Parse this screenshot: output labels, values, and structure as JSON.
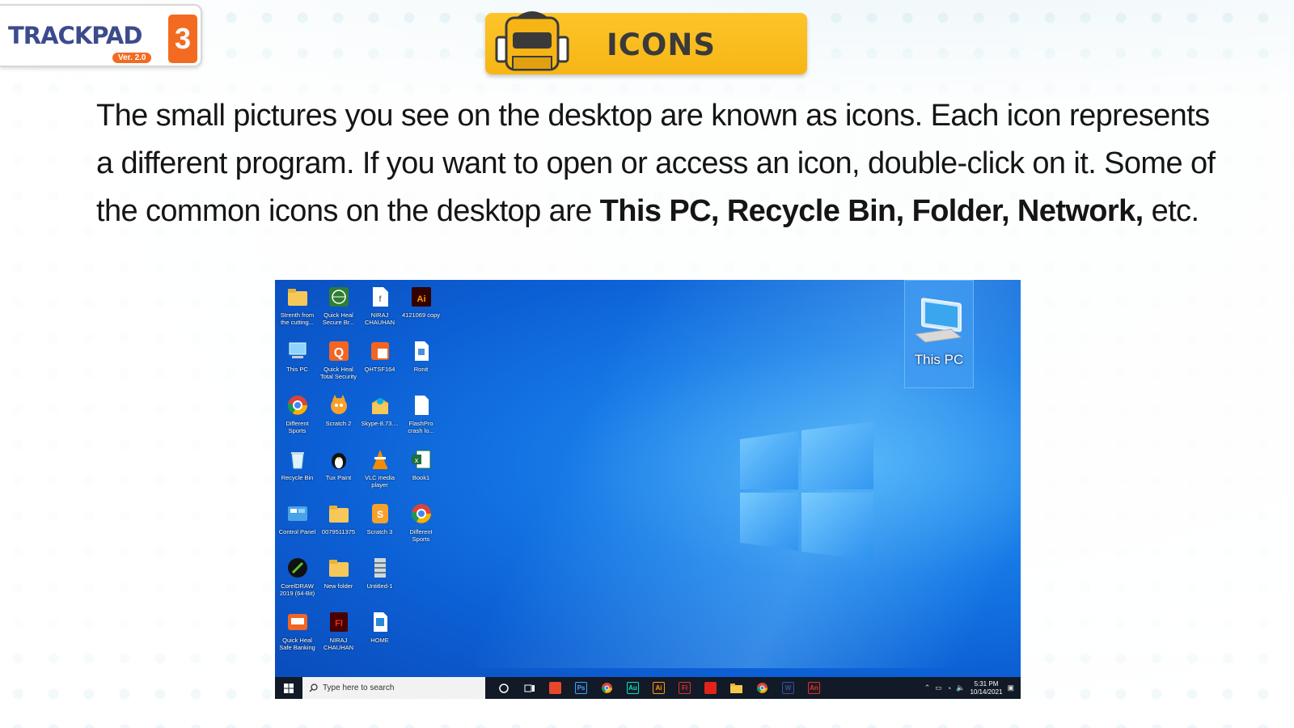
{
  "logo": {
    "brand": "TRACKPAD",
    "version": "Ver. 2.0",
    "level": "3"
  },
  "banner": {
    "title": "ICONS"
  },
  "paragraph": {
    "text": "The small pictures you see on the desktop are known as icons. Each icon represents a different program. If you want to open or access an icon, double-click on it. Some of the common icons on the desktop are ",
    "bold_icons": "This PC, Recycle Bin, Folder, Network,",
    "tail": " etc."
  },
  "desktop": {
    "icons": [
      {
        "label": "Strenth from the cutting...",
        "icon": "folder-icon"
      },
      {
        "label": "Quick Heal Secure Br...",
        "icon": "globe-icon"
      },
      {
        "label": "NIRAJ CHAUHAN",
        "icon": "swf-file-icon"
      },
      {
        "label": "4121069 copy",
        "icon": "illustrator-icon"
      },
      {
        "label": "This PC",
        "icon": "monitor-icon"
      },
      {
        "label": "Quick Heal Total Security",
        "icon": "quickheal-icon"
      },
      {
        "label": "QHTSF164",
        "icon": "installer-icon"
      },
      {
        "label": "Ronit",
        "icon": "document-icon"
      },
      {
        "label": "Different Sports",
        "icon": "chrome-icon"
      },
      {
        "label": "Scratch 2",
        "icon": "scratch-cat-icon"
      },
      {
        "label": "Skype-8.73....",
        "icon": "installer-box-icon"
      },
      {
        "label": "FlashPro crash lo...",
        "icon": "blank-file-icon"
      },
      {
        "label": "Recycle Bin",
        "icon": "recycle-bin-icon"
      },
      {
        "label": "Tux Paint",
        "icon": "penguin-icon"
      },
      {
        "label": "VLC media player",
        "icon": "vlc-cone-icon"
      },
      {
        "label": "Book1",
        "icon": "excel-icon"
      },
      {
        "label": "Control Panel",
        "icon": "control-panel-icon"
      },
      {
        "label": "0079511375",
        "icon": "folder-icon"
      },
      {
        "label": "Scratch 3",
        "icon": "scratch3-icon"
      },
      {
        "label": "Different Sports",
        "icon": "chrome-icon"
      },
      {
        "label": "CorelDRAW 2019 (64-Bit)",
        "icon": "coreldraw-icon"
      },
      {
        "label": "New folder",
        "icon": "folder-icon"
      },
      {
        "label": "Untitled-1",
        "icon": "archive-icon"
      },
      null,
      {
        "label": "Quick Heal Safe Banking",
        "icon": "safe-banking-icon"
      },
      {
        "label": "NIRAJ CHAUHAN",
        "icon": "flash-icon"
      },
      {
        "label": "HOME",
        "icon": "shortcut-file-icon"
      }
    ],
    "selected_icon": {
      "label": "This PC"
    }
  },
  "taskbar": {
    "search_placeholder": "Type here to search",
    "time": "5:31 PM",
    "date": "10/14/2021",
    "pinned": [
      {
        "name": "cortana-icon",
        "text": "",
        "color": "#ffffff"
      },
      {
        "name": "task-view-icon",
        "text": "",
        "color": "#ffffff"
      },
      {
        "name": "anydesk-icon",
        "text": "",
        "color": "#e8472c"
      },
      {
        "name": "photoshop-icon",
        "text": "Ps",
        "color": "#31a8ff"
      },
      {
        "name": "chrome-icon",
        "text": "",
        "color": "#f4b400"
      },
      {
        "name": "audition-icon",
        "text": "Au",
        "color": "#00e4bb"
      },
      {
        "name": "illustrator-icon",
        "text": "Ai",
        "color": "#ff9a00"
      },
      {
        "name": "flash-icon",
        "text": "Fl",
        "color": "#e2331c"
      },
      {
        "name": "acrobat-icon",
        "text": "",
        "color": "#e2231a"
      },
      {
        "name": "file-explorer-icon",
        "text": "",
        "color": "#f7c948"
      },
      {
        "name": "chrome-alt-icon",
        "text": "",
        "color": "#db4437"
      },
      {
        "name": "word-icon",
        "text": "W",
        "color": "#2b579a"
      },
      {
        "name": "animate-icon",
        "text": "An",
        "color": "#e2331c"
      }
    ]
  }
}
